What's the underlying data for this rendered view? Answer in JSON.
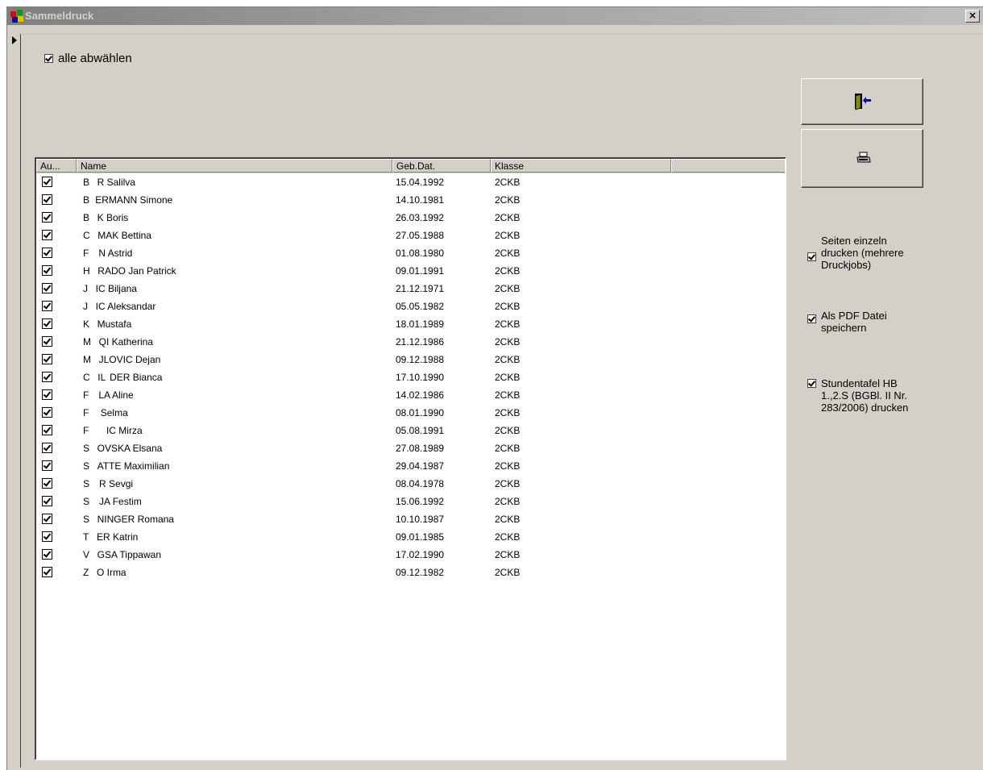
{
  "window": {
    "title": "Sammeldruck",
    "close_label": "×"
  },
  "deselect_all": {
    "label": "alle abwählen",
    "checked": true
  },
  "list": {
    "columns": [
      "Au...",
      "Name",
      "Geb.Dat.",
      "Klasse"
    ],
    "rows": [
      {
        "name": "B    R Salilva",
        "date": "15.04.1992",
        "klasse": "2CKB"
      },
      {
        "name": "B   ERMANN Simone",
        "date": "14.10.1981",
        "klasse": "2CKB"
      },
      {
        "name": "B    K Boris",
        "date": "26.03.1992",
        "klasse": "2CKB"
      },
      {
        "name": "C    MAK Bettina",
        "date": "27.05.1988",
        "klasse": "2CKB"
      },
      {
        "name": "F     N Astrid",
        "date": "01.08.1980",
        "klasse": "2CKB"
      },
      {
        "name": "H    RADO Jan Patrick",
        "date": "09.01.1991",
        "klasse": "2CKB"
      },
      {
        "name": "J    IC Biljana",
        "date": "21.12.1971",
        "klasse": "2CKB"
      },
      {
        "name": "J    IC Aleksandar",
        "date": "05.05.1982",
        "klasse": "2CKB"
      },
      {
        "name": "K    Mustafa",
        "date": "18.01.1989",
        "klasse": "2CKB"
      },
      {
        "name": "M    QI Katherina",
        "date": "21.12.1986",
        "klasse": "2CKB"
      },
      {
        "name": "M    JLOVIC Dejan",
        "date": "09.12.1988",
        "klasse": "2CKB"
      },
      {
        "name": "C    IL  DER Bianca",
        "date": "17.10.1990",
        "klasse": "2CKB"
      },
      {
        "name": "F     LA Aline",
        "date": "14.02.1986",
        "klasse": "2CKB"
      },
      {
        "name": "F      Selma",
        "date": "08.01.1990",
        "klasse": "2CKB"
      },
      {
        "name": "F         IC Mirza",
        "date": "05.08.1991",
        "klasse": "2CKB"
      },
      {
        "name": "S    OVSKA Elsana",
        "date": "27.08.1989",
        "klasse": "2CKB"
      },
      {
        "name": "S    ATTE Maximilian",
        "date": "29.04.1987",
        "klasse": "2CKB"
      },
      {
        "name": "S     R Sevgi",
        "date": "08.04.1978",
        "klasse": "2CKB"
      },
      {
        "name": "S     JA Festim",
        "date": "15.06.1992",
        "klasse": "2CKB"
      },
      {
        "name": "S    NINGER Romana",
        "date": "10.10.1987",
        "klasse": "2CKB"
      },
      {
        "name": "T    ER Katrin",
        "date": "09.01.1985",
        "klasse": "2CKB"
      },
      {
        "name": "V    GSA Tippawan",
        "date": "17.02.1990",
        "klasse": "2CKB"
      },
      {
        "name": "Z    O Irma",
        "date": "09.12.1982",
        "klasse": "2CKB"
      }
    ]
  },
  "buttons": {
    "exit_icon": "exit-door-icon",
    "print_icon": "printer-icon"
  },
  "options": [
    {
      "label": "Seiten einzeln\ndrucken (mehrere\nDruckjobs)",
      "checked": true
    },
    {
      "label": "Als PDF Datei\nspeichern",
      "checked": true
    },
    {
      "label": "Stundentafel HB\n1.,2.S (BGBl. II Nr.\n283/2006) drucken",
      "checked": true
    }
  ],
  "colors": {
    "face": "#d4d0c8",
    "title_gradient_start": "#808080",
    "door": "#8b8b00",
    "arrow": "#0000c0"
  }
}
